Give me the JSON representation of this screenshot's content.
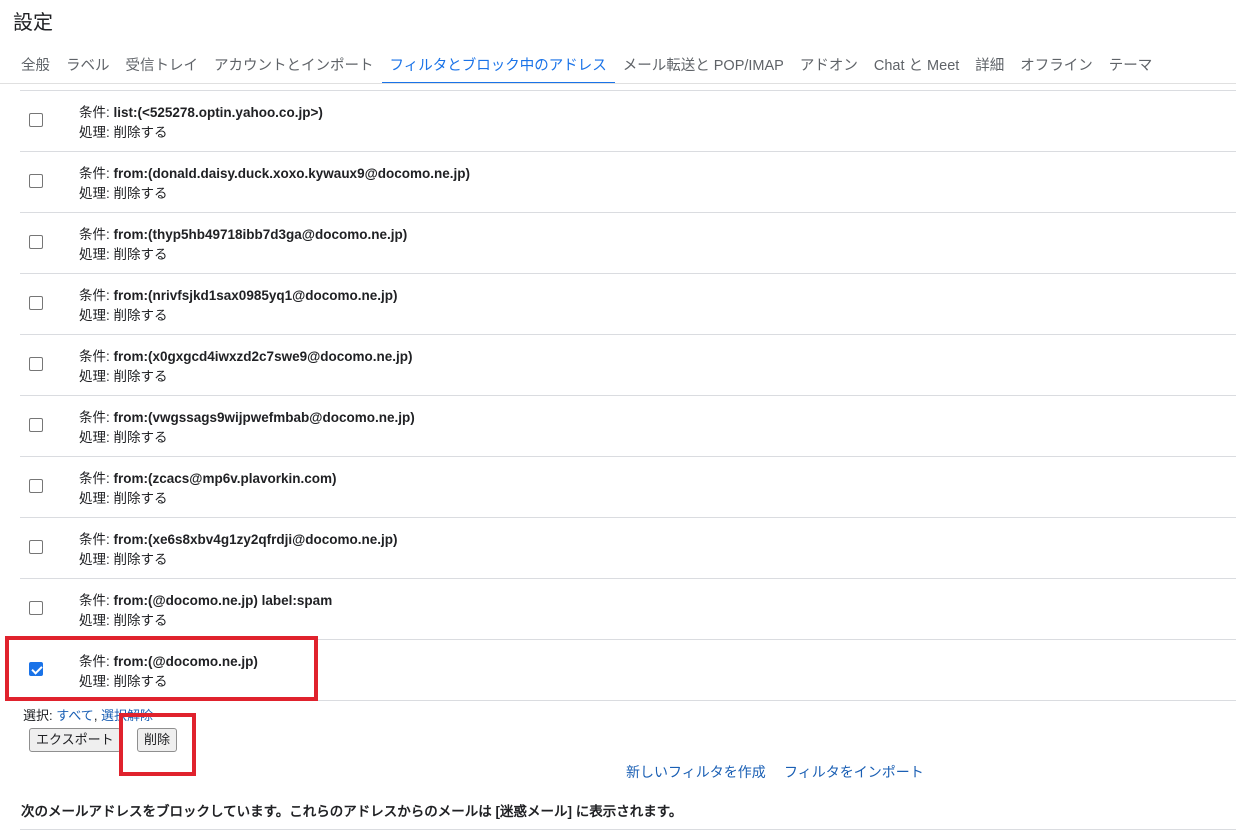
{
  "page": {
    "title": "設定"
  },
  "tabs": [
    {
      "label": "全般",
      "active": false
    },
    {
      "label": "ラベル",
      "active": false
    },
    {
      "label": "受信トレイ",
      "active": false
    },
    {
      "label": "アカウントとインポート",
      "active": false
    },
    {
      "label": "フィルタとブロック中のアドレス",
      "active": true
    },
    {
      "label": "メール転送と POP/IMAP",
      "active": false
    },
    {
      "label": "アドオン",
      "active": false
    },
    {
      "label": "Chat と Meet",
      "active": false
    },
    {
      "label": "詳細",
      "active": false
    },
    {
      "label": "オフライン",
      "active": false
    },
    {
      "label": "テーマ",
      "active": false
    }
  ],
  "filters": {
    "criteria_label": "条件: ",
    "action_label": "処理: ",
    "items": [
      {
        "criteria": "list:(<525278.optin.yahoo.co.jp>)",
        "action": "削除する",
        "checked": false
      },
      {
        "criteria": "from:(donald.daisy.duck.xoxo.kywaux9@docomo.ne.jp)",
        "action": "削除する",
        "checked": false
      },
      {
        "criteria": "from:(thyp5hb49718ibb7d3ga@docomo.ne.jp)",
        "action": "削除する",
        "checked": false
      },
      {
        "criteria": "from:(nrivfsjkd1sax0985yq1@docomo.ne.jp)",
        "action": "削除する",
        "checked": false
      },
      {
        "criteria": "from:(x0gxgcd4iwxzd2c7swe9@docomo.ne.jp)",
        "action": "削除する",
        "checked": false
      },
      {
        "criteria": "from:(vwgssags9wijpwefmbab@docomo.ne.jp)",
        "action": "削除する",
        "checked": false
      },
      {
        "criteria": "from:(zcacs@mp6v.plavorkin.com)",
        "action": "削除する",
        "checked": false
      },
      {
        "criteria": "from:(xe6s8xbv4g1zy2qfrdji@docomo.ne.jp)",
        "action": "削除する",
        "checked": false
      },
      {
        "criteria": "from:(@docomo.ne.jp) label:spam",
        "action": "削除する",
        "checked": false
      },
      {
        "criteria": "from:(@docomo.ne.jp)",
        "action": "削除する",
        "checked": true
      }
    ]
  },
  "selection": {
    "prefix": "選択: ",
    "all": "すべて",
    "separator": ", ",
    "none": "選択解除"
  },
  "buttons": {
    "export": "エクスポート",
    "delete": "削除"
  },
  "links": {
    "new_filter": "新しいフィルタを作成",
    "import_filter": "フィルタをインポート"
  },
  "block_notice": "次のメールアドレスをブロックしています。これらのアドレスからのメールは [迷惑メール] に表示されます。",
  "colors": {
    "accent": "#1a73e8",
    "link": "#1a5fb4",
    "highlight": "#e0222d"
  }
}
